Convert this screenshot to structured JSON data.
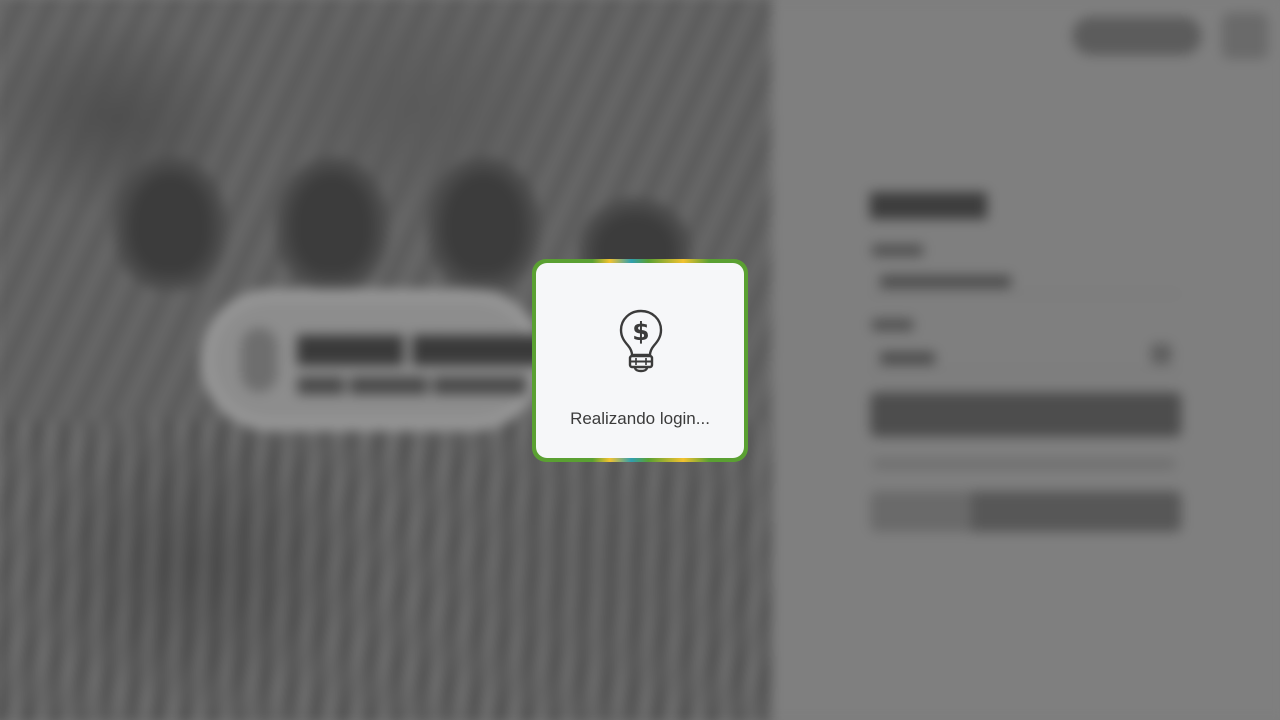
{
  "modal": {
    "icon": "lightbulb-dollar-icon",
    "message": "Realizando login...",
    "colors": {
      "border_green": "#5aa032",
      "border_yellow": "#f2c230",
      "border_teal": "#2f9fb0",
      "card_background": "#f6f7f9",
      "text": "#3b3b3b"
    }
  },
  "overlay": {
    "state": "blurred",
    "tint": "#7b7b7b"
  }
}
